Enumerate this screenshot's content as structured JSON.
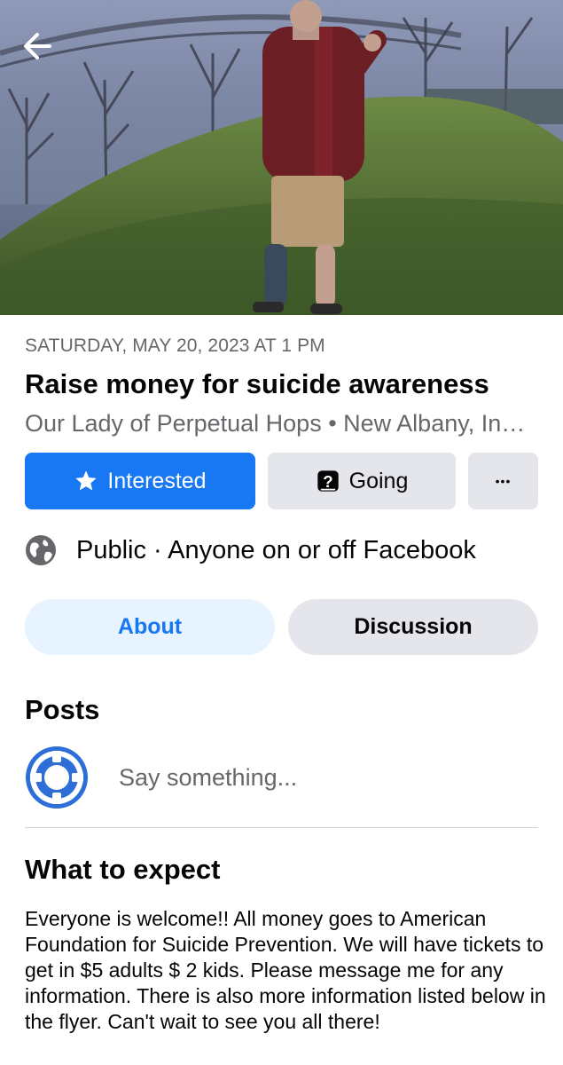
{
  "event": {
    "date": "SATURDAY, MAY 20, 2023 AT 1 PM",
    "title": "Raise money for suicide awareness",
    "location": "Our Lady of Perpetual Hops • New Albany, Indiana"
  },
  "actions": {
    "interested_label": "Interested",
    "going_label": "Going",
    "more_label": "•••"
  },
  "privacy": {
    "text": "Public · Anyone on or off Facebook",
    "icon": "globe-icon"
  },
  "tabs": [
    {
      "label": "About",
      "active": true
    },
    {
      "label": "Discussion",
      "active": false
    }
  ],
  "posts": {
    "heading": "Posts",
    "composer_placeholder": "Say something..."
  },
  "expect": {
    "heading": "What to expect",
    "body": "Everyone is welcome!! All money goes to American Foundation for Suicide Prevention. We will have tickets to get in $5 adults $ 2 kids. Please message me for any information. There is also more information listed below in the flyer. Can't wait to see you all there!"
  },
  "colors": {
    "accent": "#1877f2",
    "secondary_bg": "#e4e6eb",
    "active_tab_bg": "#e7f3ff",
    "muted_text": "#65676b"
  }
}
